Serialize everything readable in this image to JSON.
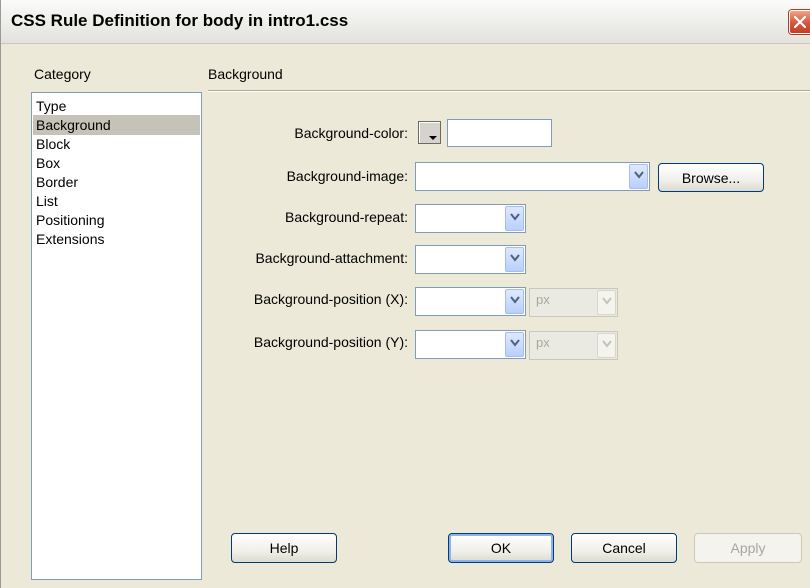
{
  "window": {
    "title": "CSS Rule Definition for body in intro1.css"
  },
  "category": {
    "label": "Category",
    "items": [
      "Type",
      "Background",
      "Block",
      "Box",
      "Border",
      "List",
      "Positioning",
      "Extensions"
    ],
    "selected": "Background"
  },
  "section": {
    "title": "Background"
  },
  "fields": {
    "bg_color": {
      "label": "Background-color:",
      "value": ""
    },
    "bg_image": {
      "label": "Background-image:",
      "value": "",
      "browse_label": "Browse..."
    },
    "bg_repeat": {
      "label": "Background-repeat:",
      "value": ""
    },
    "bg_attachment": {
      "label": "Background-attachment:",
      "value": ""
    },
    "bg_position_x": {
      "label": "Background-position (X):",
      "value": "",
      "unit": "px"
    },
    "bg_position_y": {
      "label": "Background-position (Y):",
      "value": "",
      "unit": "px"
    }
  },
  "buttons": {
    "help": "Help",
    "ok": "OK",
    "cancel": "Cancel",
    "apply": "Apply"
  },
  "colors": {
    "dialog_bg": "#ece9d8",
    "selected_bg": "#c5c2b8",
    "field_border": "#7f9db9"
  }
}
